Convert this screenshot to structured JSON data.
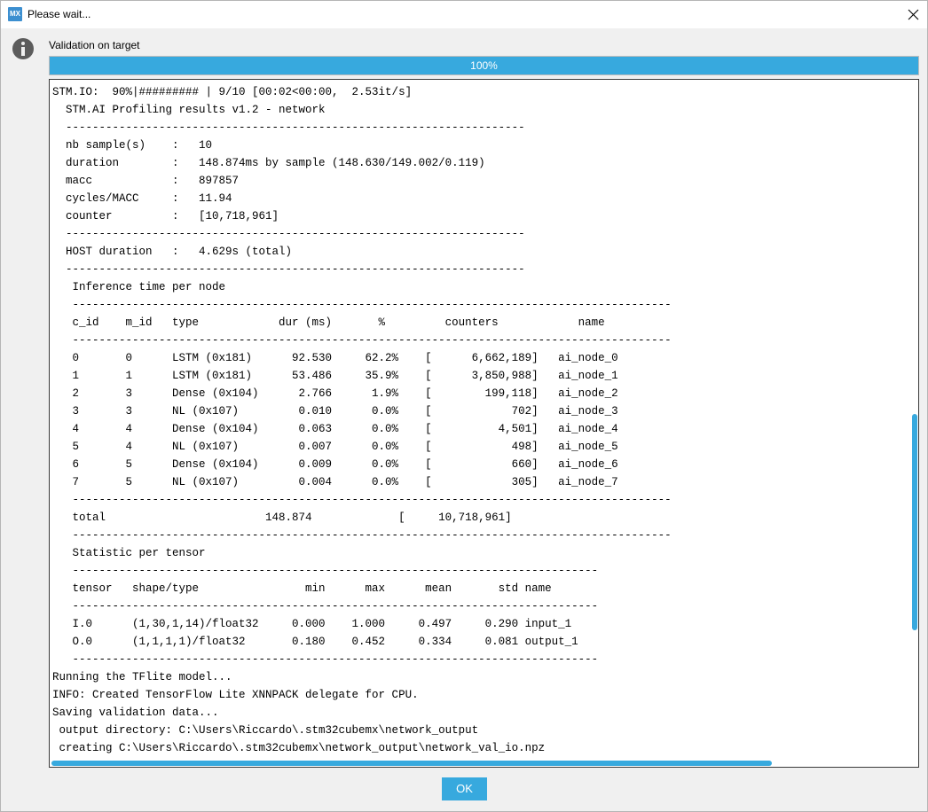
{
  "window": {
    "title": "Please wait...",
    "app_icon_text": "MX"
  },
  "message": "Validation on target",
  "progress": {
    "value_percent": 100,
    "label": "100%"
  },
  "console": {
    "lines": [
      "STM.IO:  90%|######### | 9/10 [00:02<00:00,  2.53it/s]",
      "  STM.AI Profiling results v1.2 - network",
      "  ---------------------------------------------------------------------",
      "  nb sample(s)    :   10",
      "  duration        :   148.874ms by sample (148.630/149.002/0.119)",
      "  macc            :   897857",
      "  cycles/MACC     :   11.94",
      "  counter         :   [10,718,961]",
      "  ---------------------------------------------------------------------",
      "  HOST duration   :   4.629s (total)",
      "  ---------------------------------------------------------------------",
      "   Inference time per node",
      "   ------------------------------------------------------------------------------------------",
      "   c_id    m_id   type            dur (ms)       %         counters            name",
      "   ------------------------------------------------------------------------------------------",
      "   0       0      LSTM (0x181)      92.530     62.2%    [      6,662,189]   ai_node_0",
      "   1       1      LSTM (0x181)      53.486     35.9%    [      3,850,988]   ai_node_1",
      "   2       3      Dense (0x104)      2.766      1.9%    [        199,118]   ai_node_2",
      "   3       3      NL (0x107)         0.010      0.0%    [            702]   ai_node_3",
      "   4       4      Dense (0x104)      0.063      0.0%    [          4,501]   ai_node_4",
      "   5       4      NL (0x107)         0.007      0.0%    [            498]   ai_node_5",
      "   6       5      Dense (0x104)      0.009      0.0%    [            660]   ai_node_6",
      "   7       5      NL (0x107)         0.004      0.0%    [            305]   ai_node_7",
      "   ------------------------------------------------------------------------------------------",
      "   total                        148.874             [     10,718,961]",
      "   ------------------------------------------------------------------------------------------",
      "   Statistic per tensor",
      "   -------------------------------------------------------------------------------",
      "   tensor   shape/type                min      max      mean       std name",
      "   -------------------------------------------------------------------------------",
      "   I.0      (1,30,1,14)/float32     0.000    1.000     0.497     0.290 input_1",
      "   O.0      (1,1,1,1)/float32       0.180    0.452     0.334     0.081 output_1",
      "   -------------------------------------------------------------------------------",
      "Running the TFlite model...",
      "INFO: Created TensorFlow Lite XNNPACK delegate for CPU.",
      "Saving validation data...",
      " output directory: C:\\Users\\Riccardo\\.stm32cubemx\\network_output",
      " creating C:\\Users\\Riccardo\\.stm32cubemx\\network_output\\network_val_io.npz"
    ]
  },
  "buttons": {
    "ok_label": "OK"
  },
  "colors": {
    "accent": "#37a9de",
    "info_icon": "#5c5c5c"
  }
}
